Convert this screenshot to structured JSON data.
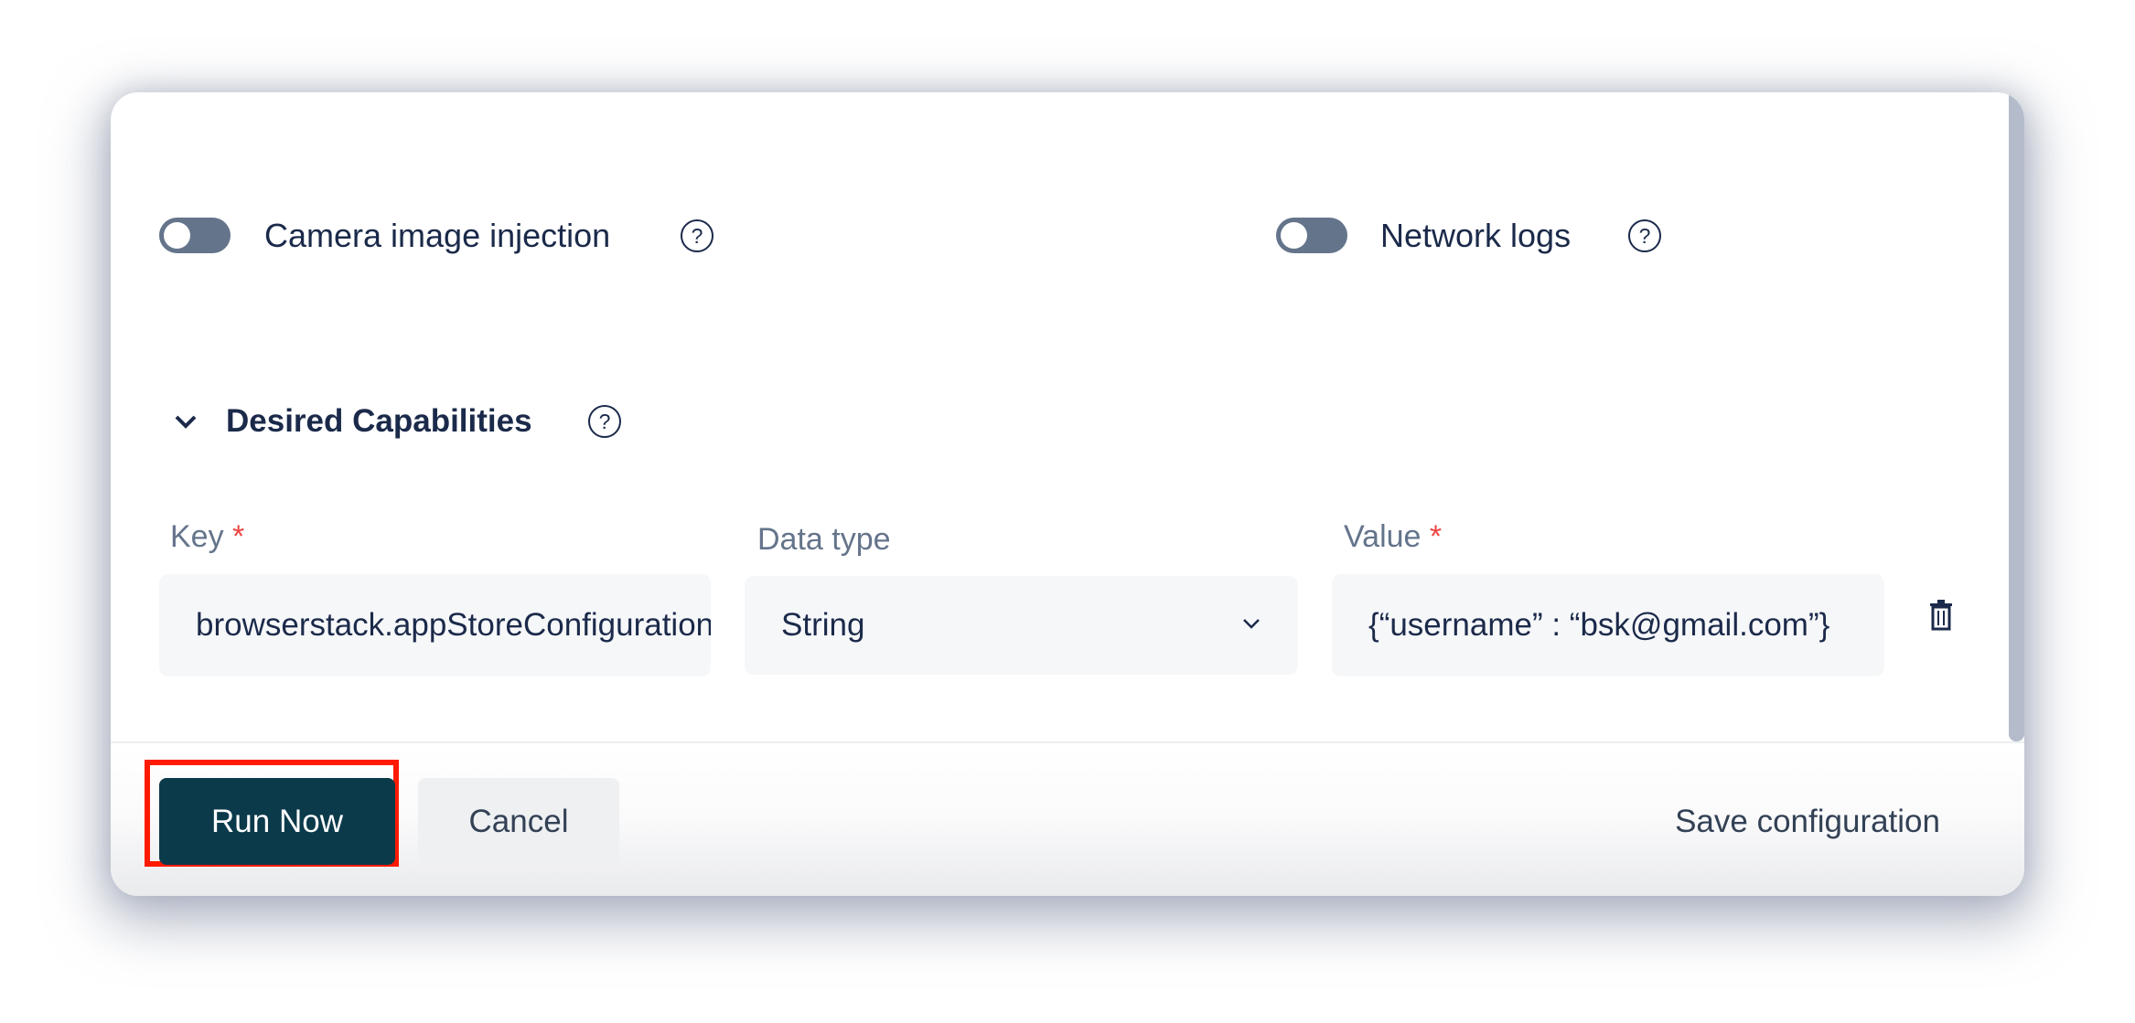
{
  "toggles": [
    {
      "label": "Camera image injection",
      "enabled": false,
      "icon": "help-circle-icon"
    },
    {
      "label": "Network logs",
      "enabled": false,
      "icon": "help-circle-icon"
    }
  ],
  "capabilities": {
    "title": "Desired Capabilities",
    "expanded": true,
    "key_label": "Key",
    "datatype_label": "Data type",
    "value_label": "Value",
    "required_mark": "*",
    "row": {
      "key": "browserstack.appStoreConfiguration",
      "datatype": "String",
      "value": "{“username” : “bsk@gmail.com”}"
    }
  },
  "footer": {
    "run_label": "Run Now",
    "cancel_label": "Cancel",
    "save_label": "Save configuration"
  },
  "colors": {
    "primary": "#0b3a4b",
    "highlight": "#ff1a00",
    "required": "#ef4444"
  }
}
